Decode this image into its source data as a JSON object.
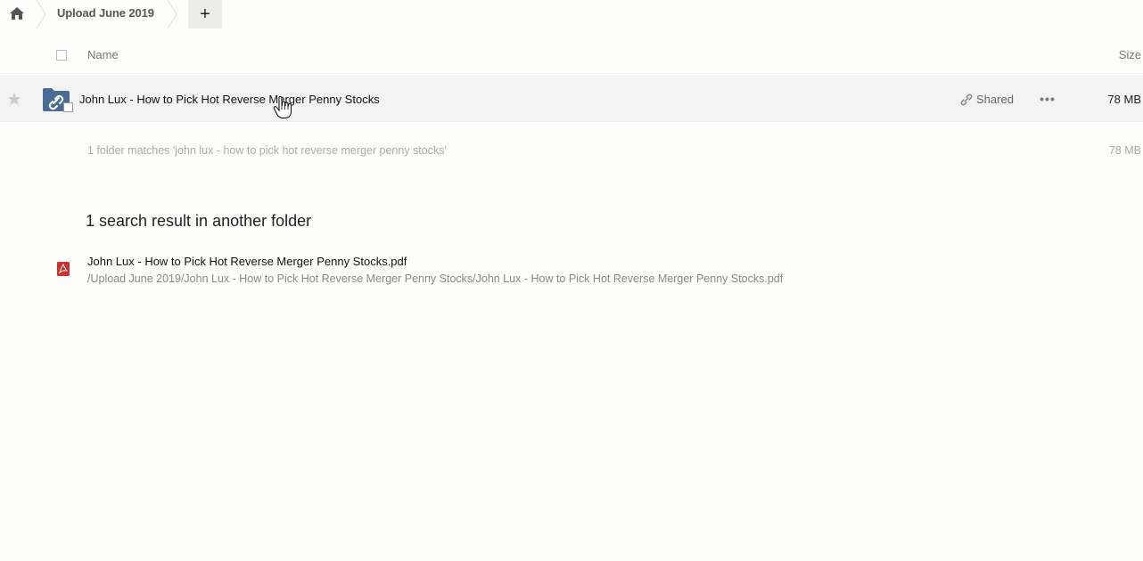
{
  "breadcrumb": {
    "folder": "Upload June 2019",
    "add_label": "+"
  },
  "table_header": {
    "name": "Name",
    "size": "Size"
  },
  "files": [
    {
      "name": "John Lux - How to Pick Hot Reverse Merger Penny Stocks",
      "shared_label": "Shared",
      "more_label": "•••",
      "size": "78 MB",
      "icon": "shared-link-folder-icon"
    }
  ],
  "summary": {
    "text": "1 folder matches 'john lux - how to pick hot reverse merger penny stocks'",
    "size": "78 MB"
  },
  "other_results": {
    "heading": "1 search result in another folder",
    "items": [
      {
        "name": "John Lux - How to Pick Hot Reverse Merger Penny Stocks.pdf",
        "path": "/Upload June 2019/John Lux - How to Pick Hot Reverse Merger Penny Stocks/John Lux - How to Pick Hot Reverse Merger Penny Stocks.pdf",
        "icon": "pdf-icon"
      }
    ]
  },
  "colors": {
    "folder": "#4a6b94",
    "pdf": "#c9332d",
    "row_hover": "#f3f3f3"
  }
}
